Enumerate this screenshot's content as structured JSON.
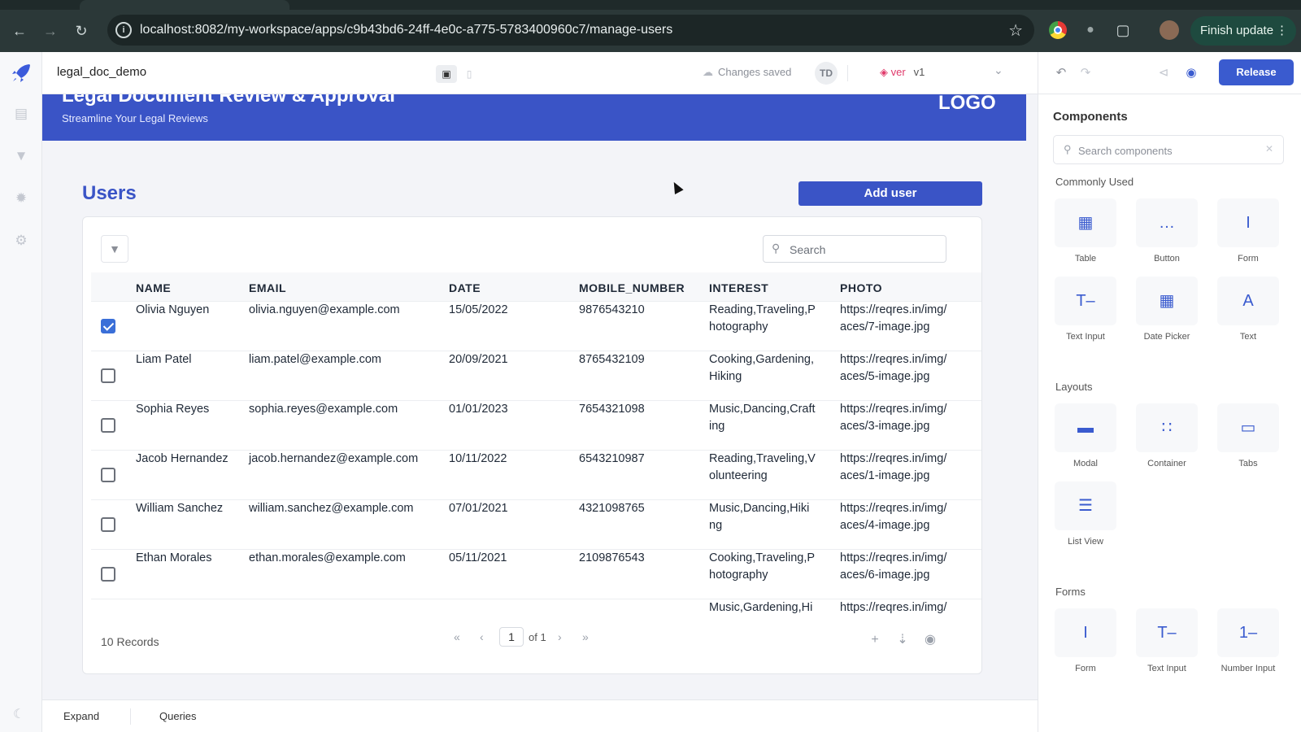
{
  "browser": {
    "url": "localhost:8082/my-workspace/apps/c9b43bd6-24ff-4e0c-a775-5783400960c7/manage-users",
    "finish_update": "Finish update",
    "back_icon": "arrow-left-icon",
    "forward_icon": "arrow-right-icon",
    "reload_icon": "reload-icon"
  },
  "header": {
    "app_name": "legal_doc_demo",
    "save_status": "Changes saved",
    "user_initials": "TD",
    "version_label": "ver",
    "version_value": "v1",
    "release": "Release"
  },
  "banner": {
    "title": "Legal Document Review & Approval",
    "subtitle": "Streamline Your Legal Reviews",
    "logo": "LOGO",
    "color": "#3a54c6"
  },
  "users_section": {
    "title": "Users",
    "add_user": "Add user",
    "search_placeholder": "Search"
  },
  "table": {
    "columns": [
      "NAME",
      "EMAIL",
      "DATE",
      "MOBILE_NUMBER",
      "INTEREST",
      "PHOTO"
    ],
    "rows": [
      {
        "checked": true,
        "name": "Olivia Nguyen",
        "email": "olivia.nguyen@example.com",
        "date": "15/05/2022",
        "mobile": "9876543210",
        "interest": "Reading,Traveling,P hotography",
        "photo": "https://reqres.in/img/ aces/7-image.jpg"
      },
      {
        "checked": false,
        "name": "Liam Patel",
        "email": "liam.patel@example.com",
        "date": "20/09/2021",
        "mobile": "8765432109",
        "interest": "Cooking,Gardening, Hiking",
        "photo": "https://reqres.in/img/ aces/5-image.jpg"
      },
      {
        "checked": false,
        "name": "Sophia Reyes",
        "email": "sophia.reyes@example.com",
        "date": "01/01/2023",
        "mobile": "7654321098",
        "interest": "Music,Dancing,Craft ing",
        "photo": "https://reqres.in/img/ aces/3-image.jpg"
      },
      {
        "checked": false,
        "name": "Jacob Hernandez",
        "email": "jacob.hernandez@example.com",
        "date": "10/11/2022",
        "mobile": "6543210987",
        "interest": "Reading,Traveling,V olunteering",
        "photo": "https://reqres.in/img/ aces/1-image.jpg"
      },
      {
        "checked": false,
        "name": "William Sanchez",
        "email": "william.sanchez@example.com",
        "date": "07/01/2021",
        "mobile": "4321098765",
        "interest": "Music,Dancing,Hiki ng",
        "photo": "https://reqres.in/img/ aces/4-image.jpg"
      },
      {
        "checked": false,
        "name": "Ethan Morales",
        "email": "ethan.morales@example.com",
        "date": "05/11/2021",
        "mobile": "2109876543",
        "interest": "Cooking,Traveling,P hotography",
        "photo": "https://reqres.in/img/ aces/6-image.jpg"
      },
      {
        "checked": false,
        "name": "",
        "email": "",
        "date": "",
        "mobile": "",
        "interest": "Music,Gardening,Hi",
        "photo": "https://reqres.in/img/"
      }
    ],
    "records": "10 Records",
    "page": "1",
    "of_total": "of 1"
  },
  "bottombar": {
    "expand": "Expand",
    "queries": "Queries"
  },
  "panel": {
    "title": "Components",
    "search_placeholder": "Search components",
    "sections": [
      {
        "label": "Commonly Used",
        "items": [
          {
            "label": "Table",
            "icon": "table-icon"
          },
          {
            "label": "Button",
            "icon": "button-icon"
          },
          {
            "label": "Form",
            "icon": "form-icon"
          },
          {
            "label": "Text Input",
            "icon": "text-input-icon"
          },
          {
            "label": "Date Picker",
            "icon": "calendar-icon"
          },
          {
            "label": "Text",
            "icon": "text-icon"
          }
        ]
      },
      {
        "label": "Layouts",
        "items": [
          {
            "label": "Modal",
            "icon": "modal-icon"
          },
          {
            "label": "Container",
            "icon": "container-icon"
          },
          {
            "label": "Tabs",
            "icon": "tabs-icon"
          },
          {
            "label": "List View",
            "icon": "list-view-icon"
          }
        ]
      },
      {
        "label": "Forms",
        "items": [
          {
            "label": "Form",
            "icon": "form-icon"
          },
          {
            "label": "Text Input",
            "icon": "text-input-icon"
          },
          {
            "label": "Number Input",
            "icon": "number-input-icon"
          }
        ]
      }
    ]
  },
  "colors": {
    "brand": "#3a54c6",
    "release": "#3a5bcf",
    "checkbox": "#3a6fd8",
    "version": "#e03a6b"
  }
}
